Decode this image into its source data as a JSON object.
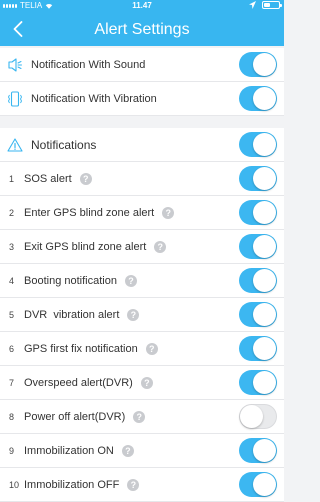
{
  "status_bar": {
    "carrier": "TELIA",
    "time": "11.47"
  },
  "header": {
    "title": "Alert Settings"
  },
  "top_settings": [
    {
      "label": "Notification With Sound",
      "icon": "speaker-icon",
      "on": true
    },
    {
      "label": "Notification With Vibration",
      "icon": "vibration-icon",
      "on": true
    }
  ],
  "notifications_header": {
    "label": "Notifications",
    "icon": "warning-triangle-icon",
    "on": true
  },
  "alerts": [
    {
      "num": "1",
      "label": "SOS alert",
      "on": true
    },
    {
      "num": "2",
      "label": "Enter GPS blind zone alert",
      "on": true
    },
    {
      "num": "3",
      "label": "Exit GPS blind zone alert",
      "on": true
    },
    {
      "num": "4",
      "label": "Booting notification",
      "on": true
    },
    {
      "num": "5",
      "label": "DVR  vibration alert",
      "on": true
    },
    {
      "num": "6",
      "label": "GPS first fix notification",
      "on": true
    },
    {
      "num": "7",
      "label": "Overspeed alert(DVR)",
      "on": true
    },
    {
      "num": "8",
      "label": "Power off alert(DVR)",
      "on": false
    },
    {
      "num": "9",
      "label": "Immobilization ON",
      "on": true
    },
    {
      "num": "10",
      "label": "Immobilization OFF",
      "on": true
    }
  ],
  "help_glyph": "?",
  "colors": {
    "accent": "#38b6f0",
    "toggle_on": "#3cb7f1",
    "toggle_off": "#e9eaec",
    "background": "#f2f3f5"
  }
}
